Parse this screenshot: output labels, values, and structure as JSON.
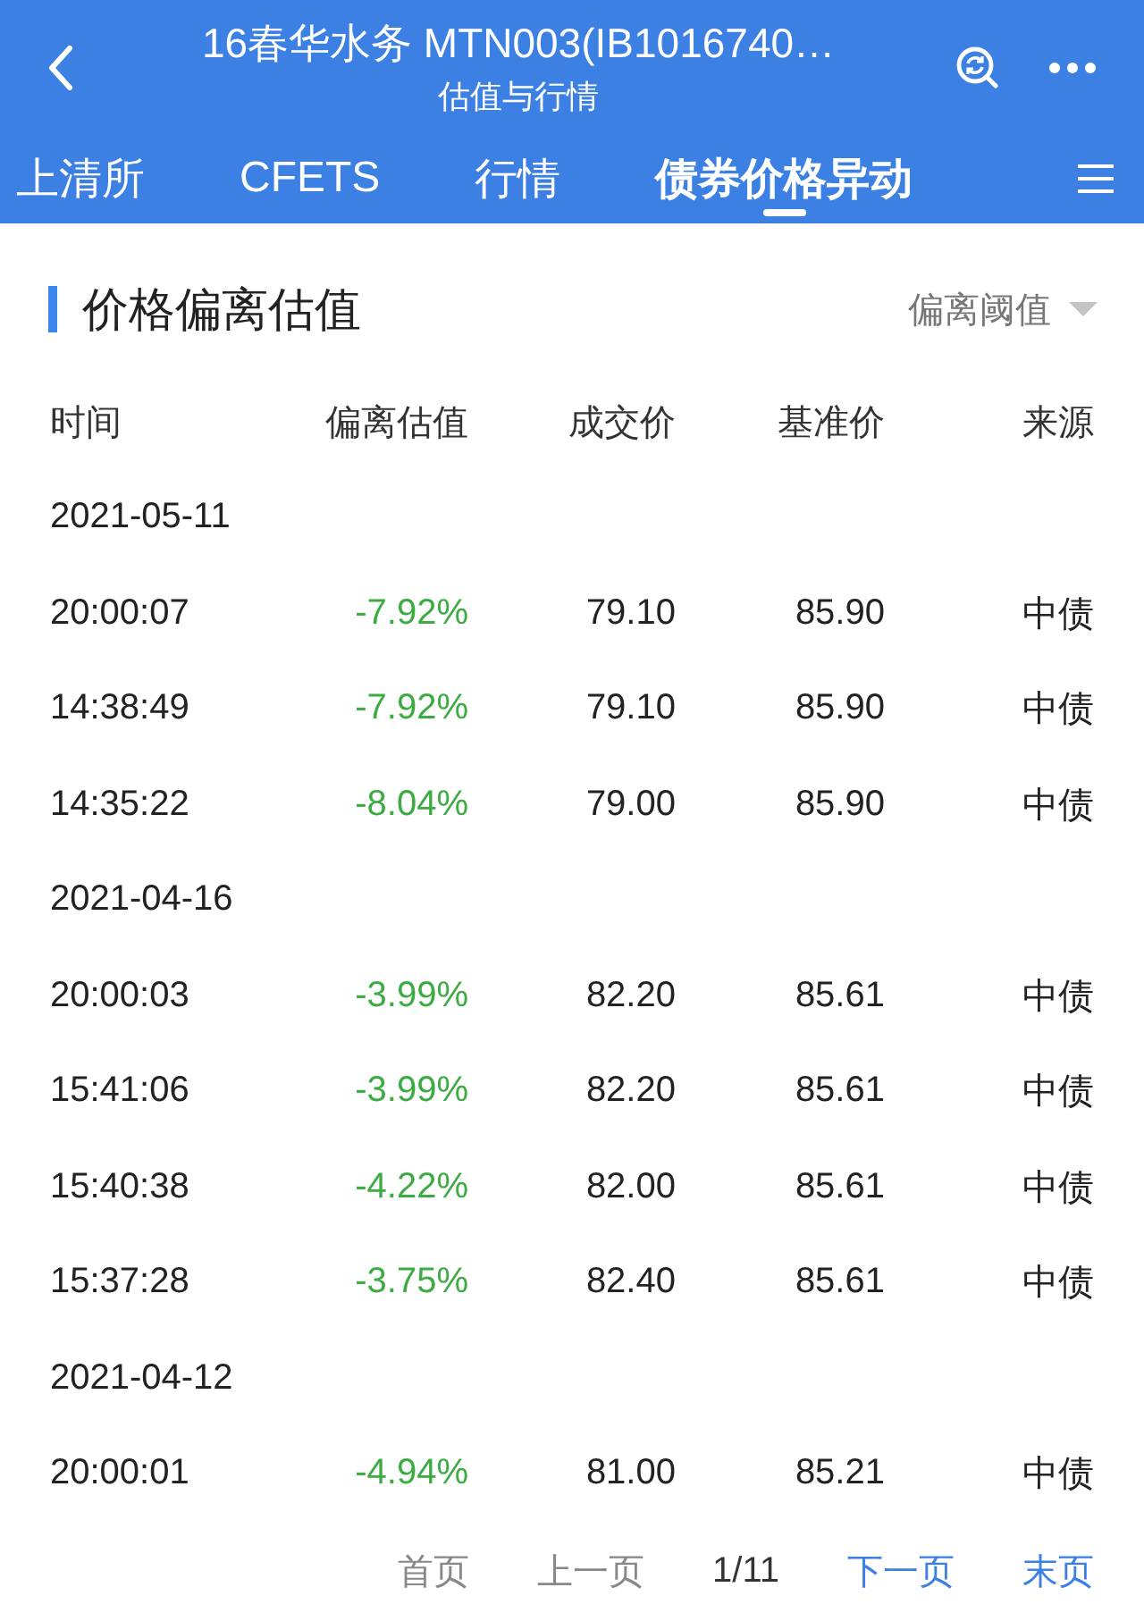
{
  "header": {
    "title": "16春华水务 MTN003(IB1016740…",
    "subtitle": "估值与行情"
  },
  "tabs": [
    {
      "label": "上清所",
      "selected": false
    },
    {
      "label": "CFETS",
      "selected": false
    },
    {
      "label": "行情",
      "selected": false
    },
    {
      "label": "债券价格异动",
      "selected": true
    }
  ],
  "section": {
    "title": "价格偏离估值",
    "filter": "偏离阈值"
  },
  "table": {
    "columns": [
      "时间",
      "偏离估值",
      "成交价",
      "基准价",
      "来源"
    ],
    "groups": [
      {
        "date": "2021-05-11",
        "rows": [
          {
            "time": "20:00:07",
            "deviation": "-7.92%",
            "price": "79.10",
            "benchmark": "85.90",
            "source": "中债"
          },
          {
            "time": "14:38:49",
            "deviation": "-7.92%",
            "price": "79.10",
            "benchmark": "85.90",
            "source": "中债"
          },
          {
            "time": "14:35:22",
            "deviation": "-8.04%",
            "price": "79.00",
            "benchmark": "85.90",
            "source": "中债"
          }
        ]
      },
      {
        "date": "2021-04-16",
        "rows": [
          {
            "time": "20:00:03",
            "deviation": "-3.99%",
            "price": "82.20",
            "benchmark": "85.61",
            "source": "中债"
          },
          {
            "time": "15:41:06",
            "deviation": "-3.99%",
            "price": "82.20",
            "benchmark": "85.61",
            "source": "中债"
          },
          {
            "time": "15:40:38",
            "deviation": "-4.22%",
            "price": "82.00",
            "benchmark": "85.61",
            "source": "中债"
          },
          {
            "time": "15:37:28",
            "deviation": "-3.75%",
            "price": "82.40",
            "benchmark": "85.61",
            "source": "中债"
          }
        ]
      },
      {
        "date": "2021-04-12",
        "rows": [
          {
            "time": "20:00:01",
            "deviation": "-4.94%",
            "price": "81.00",
            "benchmark": "85.21",
            "source": "中债"
          }
        ]
      }
    ]
  },
  "pager": [
    {
      "kind": "link",
      "label": "首页",
      "disabled": true
    },
    {
      "kind": "link",
      "label": "上一页",
      "disabled": true
    },
    {
      "kind": "count",
      "label": "1/11"
    },
    {
      "kind": "link",
      "label": "下一页",
      "disabled": false
    },
    {
      "kind": "link",
      "label": "末页",
      "disabled": false
    }
  ]
}
